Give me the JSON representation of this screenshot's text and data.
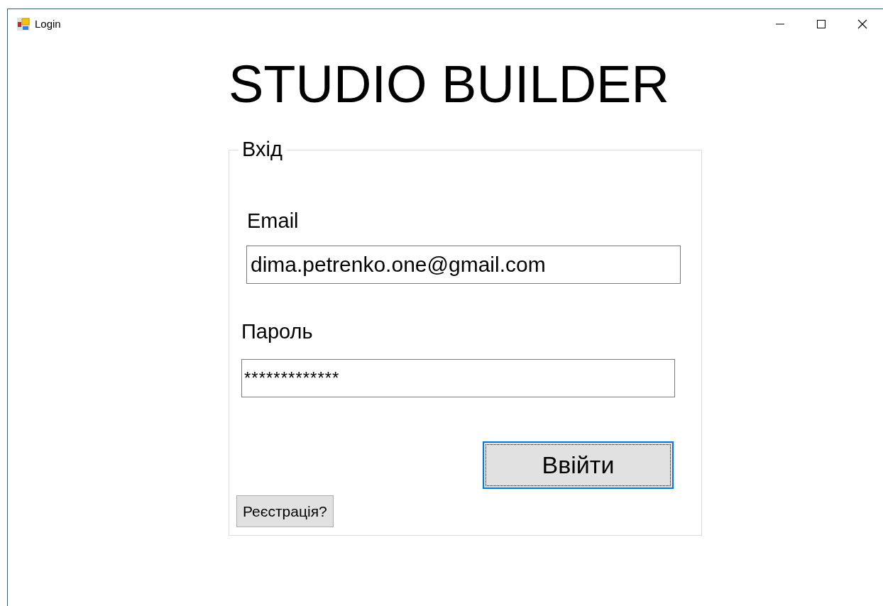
{
  "window": {
    "title": "Login"
  },
  "app_title": "STUDIO BUILDER",
  "group": {
    "legend": "Вхід",
    "email": {
      "label": "Email",
      "value": "dima.petrenko.one@gmail.com"
    },
    "password": {
      "label": "Пароль",
      "value": "*************"
    },
    "login_button": {
      "label": "Ввійти",
      "focused": true
    },
    "register_button": {
      "label": "Реєстрація?"
    }
  }
}
